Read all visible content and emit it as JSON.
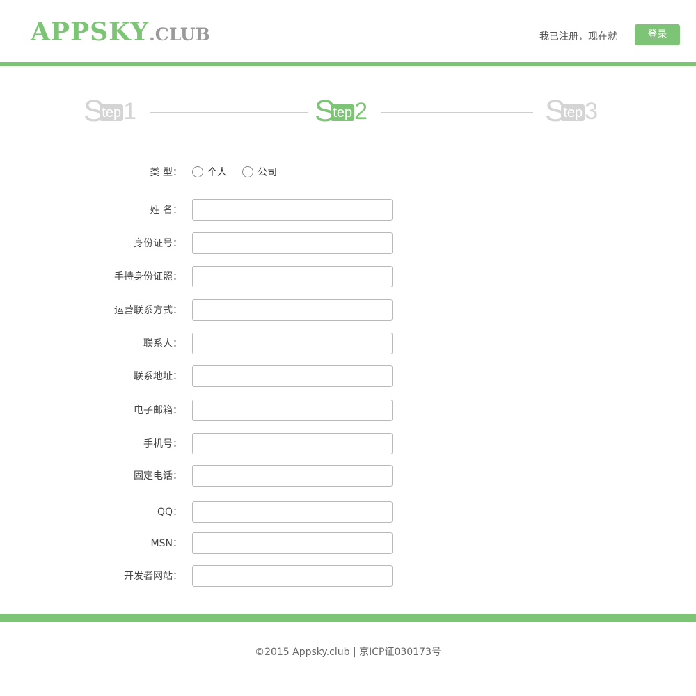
{
  "header": {
    "logo_main": "APPSKY",
    "logo_sub": ".CLUB",
    "note": "我已注册，现在就",
    "login_label": "登录"
  },
  "steps": [
    {
      "s": "S",
      "tep": "tep",
      "num": "1",
      "state": "inactive"
    },
    {
      "s": "S",
      "tep": "tep",
      "num": "2",
      "state": "active"
    },
    {
      "s": "S",
      "tep": "tep",
      "num": "3",
      "state": "inactive"
    }
  ],
  "form": {
    "type_label": "类  型：",
    "type_options": [
      "个人",
      "公司"
    ],
    "fields": [
      {
        "label": "姓  名：",
        "value": ""
      },
      {
        "label": "身份证号：",
        "value": ""
      },
      {
        "label": "手持身份证照：",
        "value": ""
      },
      {
        "label": "运营联系方式：",
        "value": ""
      },
      {
        "label": "联系人：",
        "value": ""
      },
      {
        "label": "联系地址：",
        "value": ""
      },
      {
        "label": "电子邮箱：",
        "value": ""
      },
      {
        "label": "手机号：",
        "value": ""
      },
      {
        "label": "固定电话：",
        "value": ""
      },
      {
        "label": "QQ：",
        "value": ""
      },
      {
        "label": "MSN：",
        "value": ""
      },
      {
        "label": "开发者网站：",
        "value": ""
      }
    ]
  },
  "footer": {
    "text": "©2015 Appsky.club  |  京ICP证030173号"
  },
  "colors": {
    "accent": "#7ec476",
    "inactive": "#d4d4d4"
  }
}
